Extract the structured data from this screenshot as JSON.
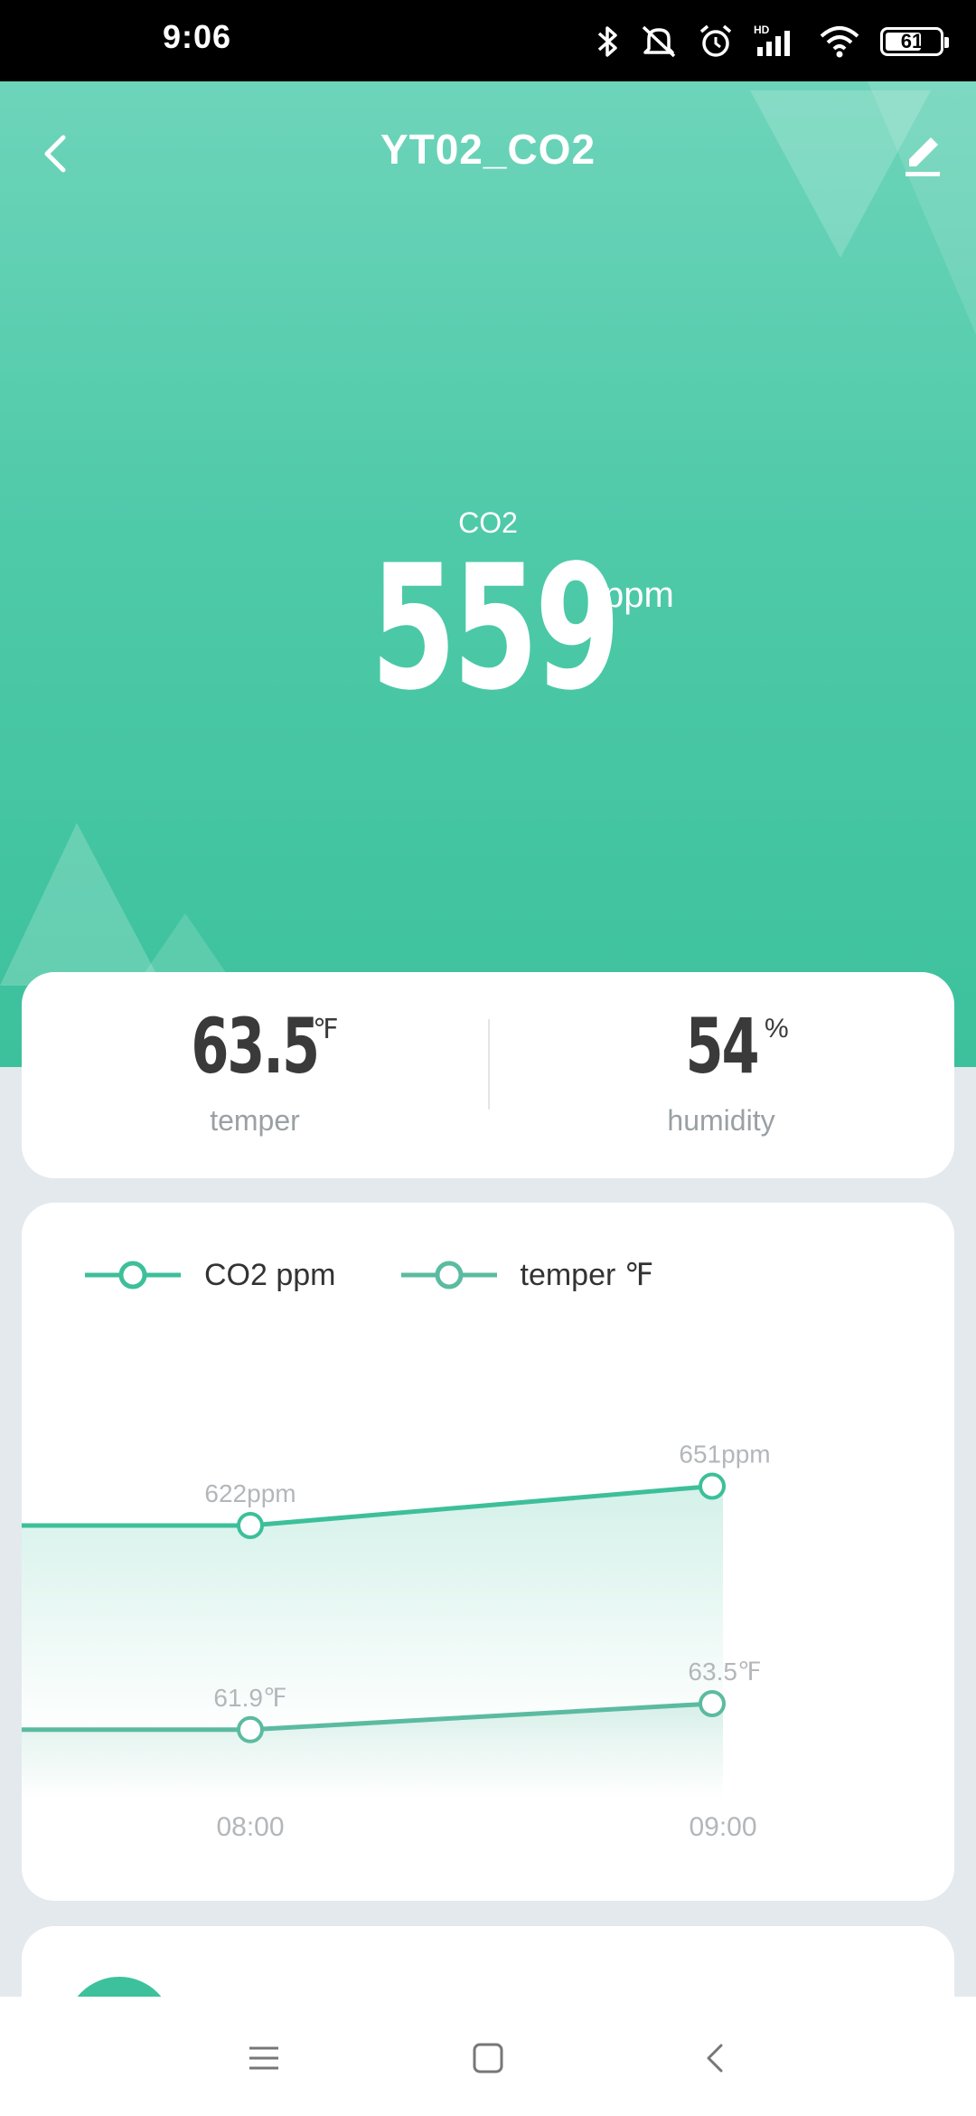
{
  "status_bar": {
    "time": "9:06",
    "battery": "61",
    "icons": [
      "bluetooth-icon",
      "mute-icon",
      "alarm-icon",
      "signal-icon",
      "wifi-icon",
      "battery-icon"
    ]
  },
  "header": {
    "title": "YT02_CO2",
    "back_icon": "chevron-left-icon",
    "edit_icon": "pencil-icon"
  },
  "hero_metric": {
    "label": "CO2",
    "value": "559",
    "unit": "ppm"
  },
  "stats": [
    {
      "value": "63.5",
      "unit": "℉",
      "label": "temper"
    },
    {
      "value": "54",
      "unit": "%",
      "label": "humidity"
    }
  ],
  "chart_data": {
    "type": "line",
    "categories": [
      "08:00",
      "09:00"
    ],
    "series": [
      {
        "name": "CO2 ppm",
        "values": [
          622,
          651
        ],
        "labels": [
          "622ppm",
          "651ppm"
        ]
      },
      {
        "name": "temper ℉",
        "values": [
          61.9,
          63.5
        ],
        "labels": [
          "61.9℉",
          "63.5℉"
        ]
      }
    ],
    "legend": "top-left",
    "grid": false
  },
  "colors": {
    "accent": "#3cc19c",
    "co2_line": "#3dbf9a",
    "temp_line": "#5bbba0",
    "label_gray": "#b3b7ba"
  },
  "nav_bar": {
    "icons": [
      "menu-icon",
      "home-square-icon",
      "back-triangle-icon"
    ]
  }
}
